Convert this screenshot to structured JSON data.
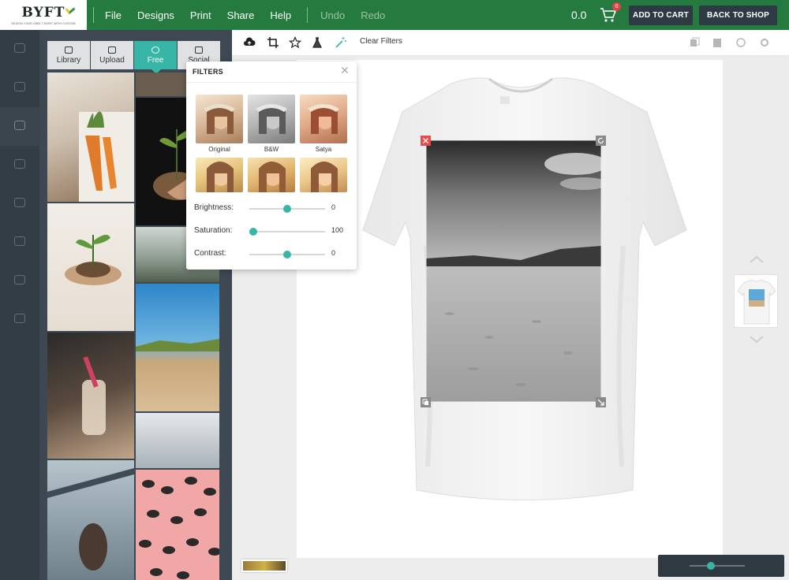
{
  "header": {
    "logo_text": "BYFT",
    "logo_tagline": "DESIGN YOUR OWN T-SHIRT WITH CUSTOM",
    "menu": [
      "File",
      "Designs",
      "Print",
      "Share",
      "Help"
    ],
    "undo_label": "Undo",
    "redo_label": "Redo",
    "price": "0.0",
    "cart_count": "0",
    "add_to_cart_label": "ADD TO CART",
    "back_to_shop_label": "BACK TO SHOP"
  },
  "library": {
    "tabs": [
      {
        "label": "Library",
        "icon": "eye-icon"
      },
      {
        "label": "Upload",
        "icon": "upload-icon"
      },
      {
        "label": "Free",
        "icon": "globe-icon"
      },
      {
        "label": "Social",
        "icon": "image-icon"
      }
    ],
    "active_tab": "Free"
  },
  "toolbar": {
    "clear_filters_label": "Clear Filters"
  },
  "filters": {
    "title": "FILTERS",
    "presets": [
      {
        "label": "Original"
      },
      {
        "label": "B&W"
      },
      {
        "label": "Satya"
      },
      {
        "label": ""
      },
      {
        "label": ""
      },
      {
        "label": ""
      }
    ],
    "brightness": {
      "label": "Brightness:",
      "value": 0,
      "fraction": 0.5
    },
    "saturation": {
      "label": "Saturation:",
      "value": 100,
      "fraction": 0.05
    },
    "contrast": {
      "label": "Contrast:",
      "value": 0,
      "fraction": 0.5
    }
  },
  "colors": {
    "brand_green": "#247a3f",
    "accent_teal": "#37b6a8",
    "dark_panel": "#3d4852",
    "delete_red": "#e74c4c"
  }
}
